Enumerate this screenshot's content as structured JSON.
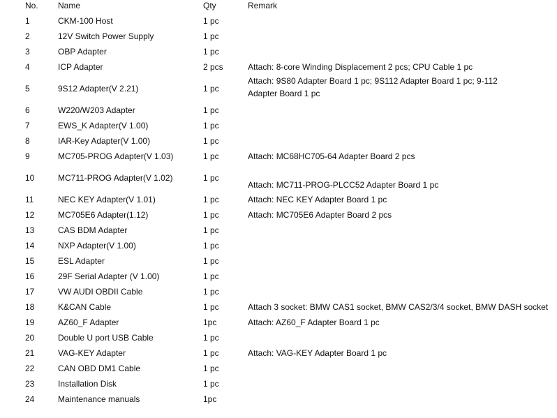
{
  "header": {
    "no": "No.",
    "name": "Name",
    "qty": "Qty",
    "remark": "Remark"
  },
  "rows": [
    {
      "no": "1",
      "name": "CKM-100 Host",
      "qty": "1 pc",
      "remark": ""
    },
    {
      "no": "2",
      "name": "12V Switch Power Supply",
      "qty": "1 pc",
      "remark": ""
    },
    {
      "no": "3",
      "name": "OBP Adapter",
      "qty": "1 pc",
      "remark": ""
    },
    {
      "no": "4",
      "name": "ICP Adapter",
      "qty": "2 pcs",
      "remark": "Attach: 8-core Winding Displacement 2 pcs;  CPU Cable 1 pc"
    },
    {
      "no": "5",
      "name": "9S12 Adapter(V 2.21)",
      "qty": "1 pc",
      "remark": "Attach: 9S80 Adapter Board 1 pc; 9S112 Adapter Board 1 pc; 9-112 Adapter Board 1 pc"
    },
    {
      "no": "6",
      "name": "W220/W203 Adapter",
      "qty": "1 pc",
      "remark": ""
    },
    {
      "no": "7",
      "name": "EWS_K Adapter(V 1.00)",
      "qty": "1 pc",
      "remark": ""
    },
    {
      "no": "8",
      "name": "IAR-Key Adapter(V 1.00)",
      "qty": "1 pc",
      "remark": ""
    },
    {
      "no": "9",
      "name": "MC705-PROG Adapter(V 1.03)",
      "qty": "1 pc",
      "remark": "Attach: MC68HC705-64 Adapter Board 2 pcs"
    },
    {
      "no": "10",
      "name": "MC711-PROG Adapter(V 1.02)",
      "qty": "1 pc",
      "remark": "Attach: MC711-PROG-PLCC52 Adapter Board 1 pc"
    },
    {
      "no": "11",
      "name": "NEC KEY Adapter(V 1.01)",
      "qty": "1 pc",
      "remark": "Attach: NEC KEY Adapter Board 1 pc"
    },
    {
      "no": "12",
      "name": "MC705E6 Adapter(1.12)",
      "qty": "1 pc",
      "remark": "Attach: MC705E6 Adapter Board 2 pcs"
    },
    {
      "no": "13",
      "name": "CAS BDM Adapter",
      "qty": "1 pc",
      "remark": ""
    },
    {
      "no": "14",
      "name": "NXP Adapter(V 1.00)",
      "qty": "1 pc",
      "remark": ""
    },
    {
      "no": "15",
      "name": "ESL Adapter",
      "qty": "1 pc",
      "remark": ""
    },
    {
      "no": "16",
      "name": "29F Serial Adapter (V 1.00)",
      "qty": "1 pc",
      "remark": ""
    },
    {
      "no": "17",
      "name": "VW AUDI OBDII Cable",
      "qty": "1 pc",
      "remark": ""
    },
    {
      "no": "18",
      "name": "K&CAN Cable",
      "qty": "1 pc",
      "remark": "Attach 3 socket: BMW CAS1 socket, BMW CAS2/3/4 socket, BMW DASH socket"
    },
    {
      "no": "19",
      "name": "AZ60_F Adapter",
      "qty": "1pc",
      "remark": "Attach: AZ60_F Adapter Board 1 pc"
    },
    {
      "no": "20",
      "name": "Double U port USB Cable",
      "qty": "1 pc",
      "remark": ""
    },
    {
      "no": "21",
      "name": "VAG-KEY Adapter",
      "qty": "1 pc",
      "remark": "Attach: VAG-KEY Adapter Board 1 pc"
    },
    {
      "no": "22",
      "name": "CAN OBD DM1 Cable",
      "qty": "1 pc",
      "remark": ""
    },
    {
      "no": "23",
      "name": "Installation Disk",
      "qty": "1 pc",
      "remark": ""
    },
    {
      "no": "24",
      "name": "Maintenance manuals",
      "qty": "1pc",
      "remark": ""
    }
  ]
}
